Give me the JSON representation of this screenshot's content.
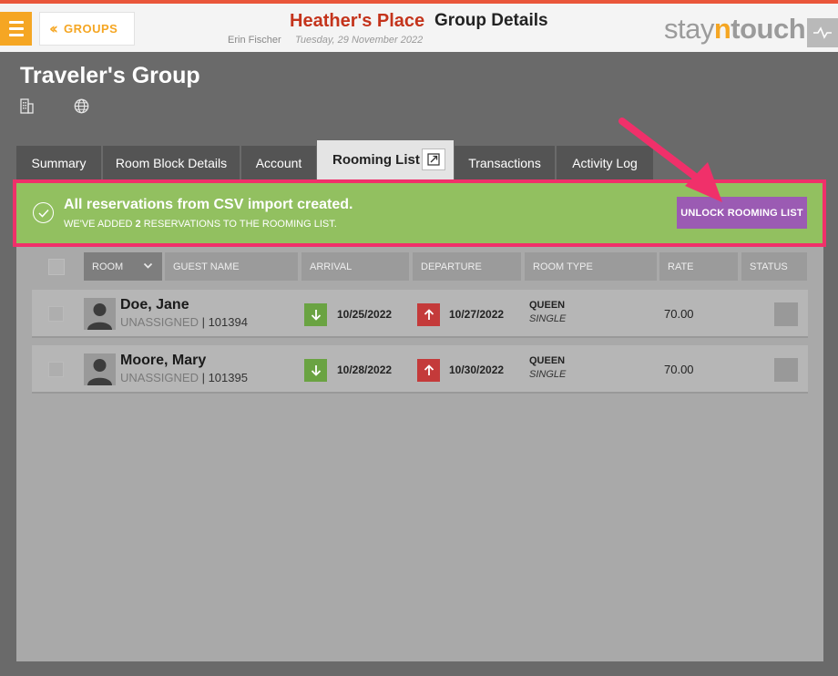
{
  "header": {
    "groups_label": "GROUPS",
    "hotel_name": "Heather's Place",
    "page_heading": "Group Details",
    "user_name": "Erin Fischer",
    "date": "Tuesday, 29 November 2022",
    "logo": {
      "part1": "stay",
      "part2": "n",
      "part3": "touch"
    },
    "accent_color": "#f5a623"
  },
  "group": {
    "title": "Traveler's Group"
  },
  "tabs": [
    {
      "label": "Summary"
    },
    {
      "label": "Room Block Details"
    },
    {
      "label": "Account"
    },
    {
      "label": "Rooming List",
      "active": true
    },
    {
      "label": "Transactions"
    },
    {
      "label": "Activity Log"
    }
  ],
  "banner": {
    "title": "All reservations from CSV import created.",
    "sub_prefix": "WE'VE ADDED",
    "sub_count": "2",
    "sub_suffix": "RESERVATIONS TO THE ROOMING LIST.",
    "button_label": "UNLOCK ROOMING LIST",
    "color": "#92c060",
    "highlight_color": "#f0306a",
    "button_color": "#9b5bb3"
  },
  "table": {
    "columns": [
      "ROOM",
      "GUEST NAME",
      "ARRIVAL",
      "DEPARTURE",
      "ROOM TYPE",
      "RATE",
      "STATUS"
    ],
    "rows": [
      {
        "name": "Doe, Jane",
        "room": "UNASSIGNED",
        "conf": "101394",
        "arrival": "10/25/2022",
        "departure": "10/27/2022",
        "room_type": "QUEEN",
        "occupancy": "SINGLE",
        "rate": "70.00"
      },
      {
        "name": "Moore, Mary",
        "room": "UNASSIGNED",
        "conf": "101395",
        "arrival": "10/28/2022",
        "departure": "10/30/2022",
        "room_type": "QUEEN",
        "occupancy": "SINGLE",
        "rate": "70.00"
      }
    ]
  }
}
